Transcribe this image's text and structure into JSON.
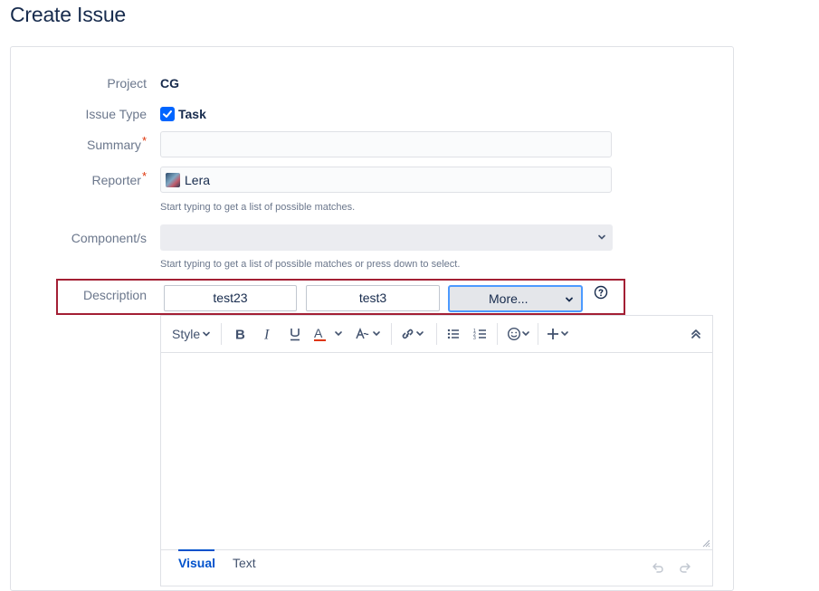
{
  "page": {
    "title": "Create Issue"
  },
  "form": {
    "project": {
      "label": "Project",
      "value": "CG"
    },
    "issue_type": {
      "label": "Issue Type",
      "value": "Task"
    },
    "summary": {
      "label": "Summary",
      "required_mark": "*",
      "value": ""
    },
    "reporter": {
      "label": "Reporter",
      "required_mark": "*",
      "value": "Lera",
      "hint": "Start typing to get a list of possible matches."
    },
    "components": {
      "label": "Component/s",
      "value": "",
      "hint": "Start typing to get a list of possible matches or press down to select."
    },
    "description": {
      "label": "Description",
      "buttons": [
        "test23",
        "test3"
      ],
      "more_label": "More...",
      "help_icon": "question-circle-icon",
      "toolbar": {
        "style_label": "Style",
        "icons": [
          "bold-icon",
          "italic-icon",
          "underline-icon",
          "text-color-icon",
          "text-effects-icon",
          "link-icon",
          "bullet-list-icon",
          "numbered-list-icon",
          "emoji-icon",
          "insert-plus-icon",
          "collapse-toolbar-icon"
        ],
        "text_color": "#de350b"
      },
      "body": "",
      "tabs": [
        "Visual",
        "Text"
      ],
      "active_tab": "Visual"
    }
  },
  "colors": {
    "accent": "#0052cc",
    "highlight_border": "#a31f34",
    "checkbox": "#0065ff"
  }
}
